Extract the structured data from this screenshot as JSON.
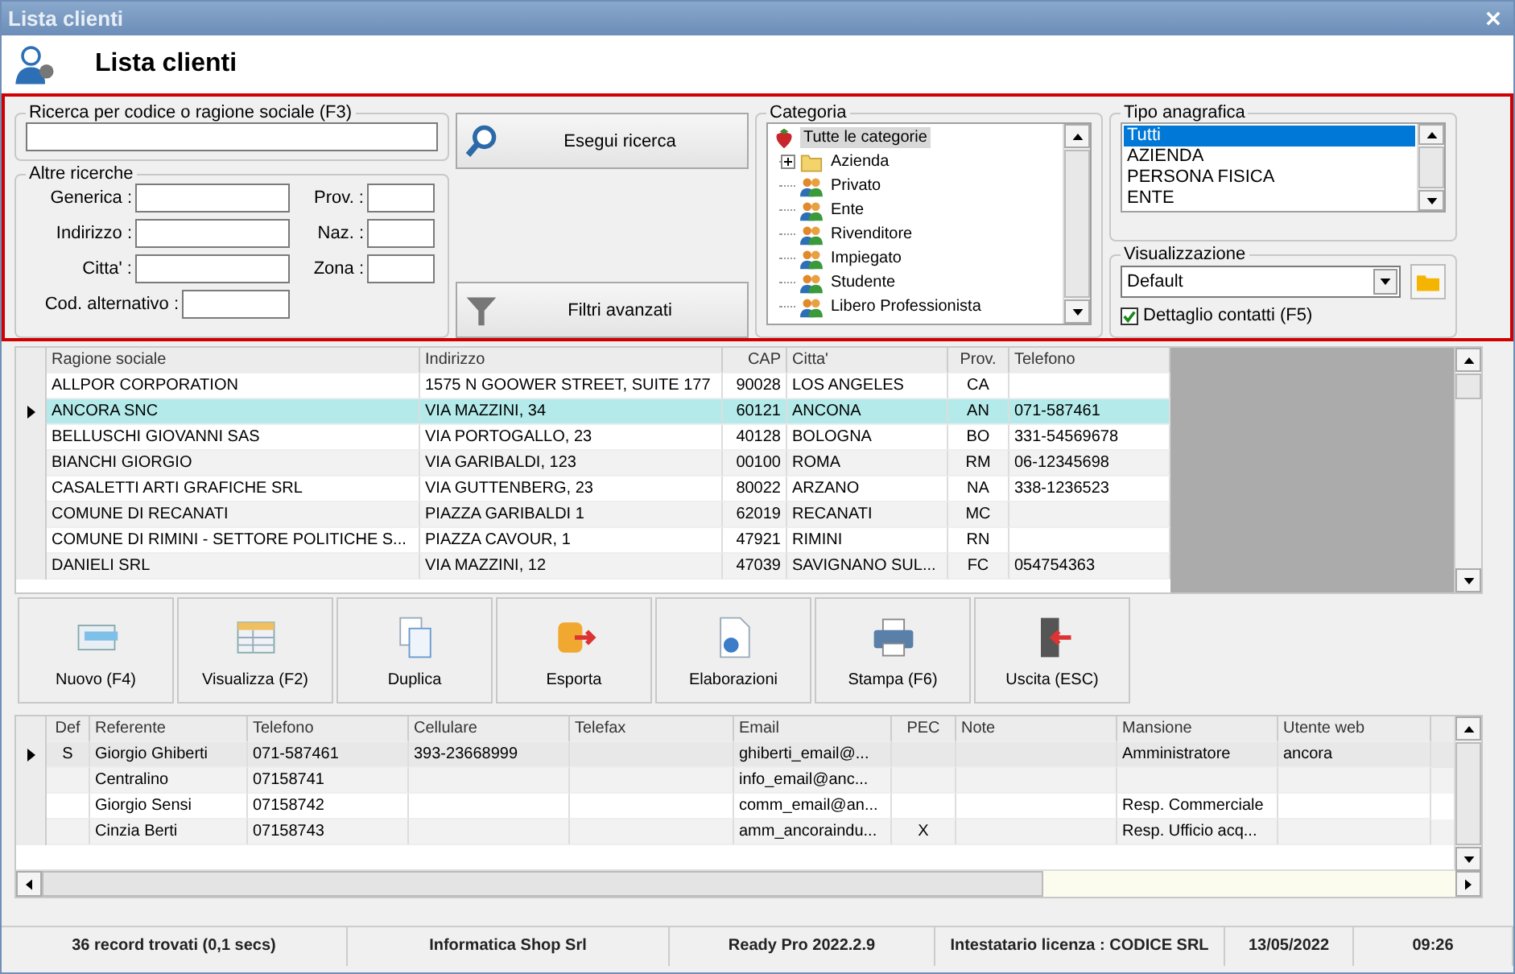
{
  "window": {
    "title": "Lista clienti"
  },
  "header": {
    "title": "Lista clienti"
  },
  "search": {
    "legend": "Ricerca per codice o ragione sociale (F3)",
    "button": "Esegui ricerca"
  },
  "other_searches": {
    "legend": "Altre ricerche",
    "fields": [
      {
        "label": "Generica :"
      },
      {
        "label": "Prov. :"
      },
      {
        "label": "Indirizzo :"
      },
      {
        "label": "Naz. :"
      },
      {
        "label": "Citta' :"
      },
      {
        "label": "Zona :"
      },
      {
        "label": "Cod. alternativo :"
      }
    ]
  },
  "advanced_filters_button": "Filtri avanzati",
  "category": {
    "legend": "Categoria",
    "root": {
      "label": "Tutte le categorie",
      "selected": true,
      "children": [
        {
          "label": "Azienda",
          "kind": "folder",
          "selected": false
        },
        {
          "label": "Privato",
          "kind": "group",
          "selected": false
        },
        {
          "label": "Ente",
          "kind": "group",
          "selected": false
        },
        {
          "label": "Rivenditore",
          "kind": "group",
          "selected": false
        },
        {
          "label": "Impiegato",
          "kind": "group",
          "selected": false
        },
        {
          "label": "Studente",
          "kind": "group",
          "selected": false
        },
        {
          "label": "Libero Professionista",
          "kind": "group",
          "selected": false
        }
      ]
    }
  },
  "registry_type": {
    "legend": "Tipo anagrafica",
    "items": [
      {
        "label": "Tutti",
        "selected": true
      },
      {
        "label": "AZIENDA",
        "selected": false
      },
      {
        "label": "PERSONA FISICA",
        "selected": false
      },
      {
        "label": "ENTE",
        "selected": false
      }
    ]
  },
  "view": {
    "legend": "Visualizzazione",
    "value": "Default",
    "contact_detail": {
      "label": "Dettaglio contatti (F5)",
      "checked": true
    }
  },
  "customers": {
    "columns": [
      "Ragione sociale",
      "Indirizzo",
      "CAP",
      "Citta'",
      "Prov.",
      "Telefono"
    ],
    "rows": [
      {
        "selected": false,
        "cells": [
          "ALLPOR CORPORATION",
          "1575 N GOOWER STREET, SUITE 177",
          "90028",
          "LOS ANGELES",
          "CA",
          ""
        ]
      },
      {
        "selected": true,
        "cells": [
          "ANCORA SNC",
          "VIA MAZZINI, 34",
          "60121",
          "ANCONA",
          "AN",
          "071-587461"
        ]
      },
      {
        "selected": false,
        "cells": [
          "BELLUSCHI GIOVANNI SAS",
          "VIA PORTOGALLO, 23",
          "40128",
          "BOLOGNA",
          "BO",
          "331-54569678"
        ]
      },
      {
        "selected": false,
        "cells": [
          "BIANCHI GIORGIO",
          "VIA GARIBALDI, 123",
          "00100",
          "ROMA",
          "RM",
          "06-12345698"
        ]
      },
      {
        "selected": false,
        "cells": [
          "CASALETTI ARTI GRAFICHE SRL",
          "VIA GUTTENBERG, 23",
          "80022",
          "ARZANO",
          "NA",
          "338-1236523"
        ]
      },
      {
        "selected": false,
        "cells": [
          "COMUNE DI RECANATI",
          "PIAZZA GARIBALDI 1",
          "62019",
          "RECANATI",
          "MC",
          ""
        ]
      },
      {
        "selected": false,
        "cells": [
          "COMUNE DI RIMINI - SETTORE POLITICHE S...",
          "PIAZZA CAVOUR, 1",
          "47921",
          "RIMINI",
          "RN",
          ""
        ]
      },
      {
        "selected": false,
        "cells": [
          "DANIELI SRL",
          "VIA MAZZINI, 12",
          "47039",
          "SAVIGNANO SUL...",
          "FC",
          "054754363"
        ]
      }
    ]
  },
  "actions": [
    "Nuovo (F4)",
    "Visualizza (F2)",
    "Duplica",
    "Esporta",
    "Elaborazioni",
    "Stampa (F6)",
    "Uscita (ESC)"
  ],
  "contacts": {
    "columns": [
      "Def",
      "Referente",
      "Telefono",
      "Cellulare",
      "Telefax",
      "Email",
      "PEC",
      "Note",
      "Mansione",
      "Utente web"
    ],
    "rows": [
      {
        "selected": true,
        "cells": [
          "S",
          "Giorgio Ghiberti",
          "071-587461",
          "393-23668999",
          "",
          "ghiberti_email@...",
          "",
          "",
          "Amministratore",
          "ancora"
        ]
      },
      {
        "selected": false,
        "cells": [
          "",
          "Centralino",
          "07158741",
          "",
          "",
          "info_email@anc...",
          "",
          "",
          "",
          ""
        ]
      },
      {
        "selected": false,
        "cells": [
          "",
          "Giorgio Sensi",
          "07158742",
          "",
          "",
          "comm_email@an...",
          "",
          "",
          "Resp. Commerciale",
          ""
        ]
      },
      {
        "selected": false,
        "cells": [
          "",
          "Cinzia Berti",
          "07158743",
          "",
          "",
          "amm_ancoraindu...",
          "X",
          "",
          "Resp. Ufficio acq...",
          ""
        ]
      }
    ]
  },
  "status_bar": [
    "36 record trovati (0,1 secs)",
    "Informatica Shop Srl",
    "Ready Pro 2022.2.9",
    "Intestatario licenza : CODICE SRL",
    "13/05/2022",
    "09:26"
  ]
}
